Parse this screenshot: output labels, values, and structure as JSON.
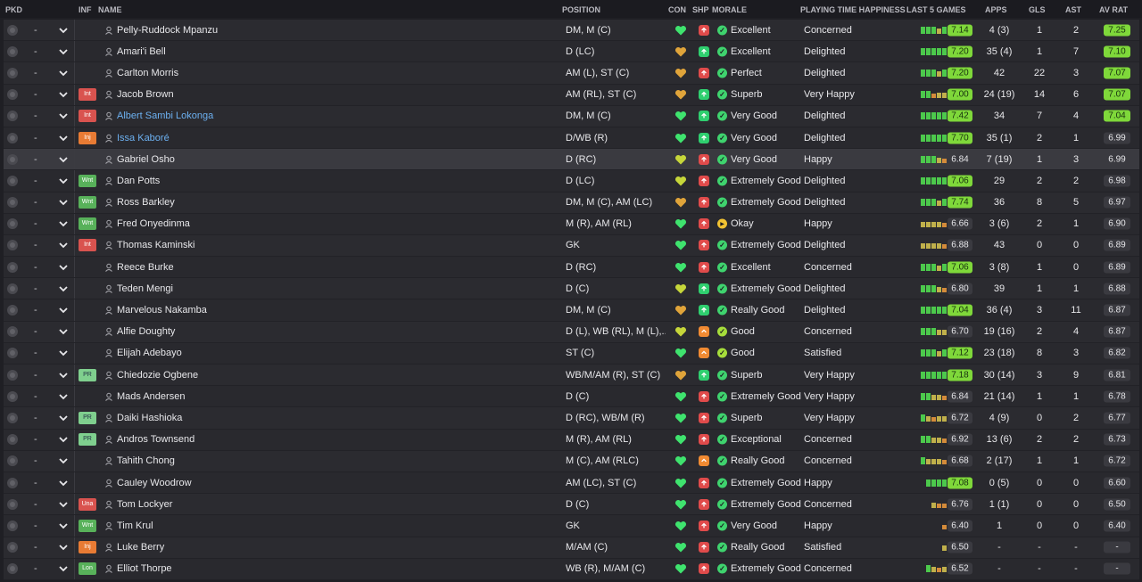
{
  "headers": {
    "pkd": "PKD",
    "inf": "INF",
    "name": "NAME",
    "position": "POSITION",
    "con": "CON",
    "shp": "SHP",
    "morale": "MORALE",
    "pth": "PLAYING TIME HAPPINESS",
    "last5": "LAST 5 GAMES",
    "apps": "APPS",
    "gls": "GLS",
    "ast": "AST",
    "avrat": "AV RAT"
  },
  "colors": {
    "rating_high": "#7fd83a",
    "link": "#6cb0f0",
    "status_red": "#d9534f",
    "status_orange": "#e87b34",
    "status_green": "#58b15a"
  },
  "rows": [
    {
      "pkd": "-",
      "inf": "",
      "name": "Pelly-Ruddock Mpanzu",
      "link": false,
      "position": "DM, M (C)",
      "con": "#3fe36e",
      "shp": "red",
      "morale_icon": "green",
      "morale": "Excellent",
      "pth": "Concerned",
      "l5": [
        "g",
        "g",
        "g",
        "y",
        "g"
      ],
      "rating": "7.14",
      "rating_hi": true,
      "apps": "4 (3)",
      "gls": "1",
      "ast": "2",
      "avrat": "7.25",
      "avrat_hi": true
    },
    {
      "pkd": "-",
      "inf": "",
      "name": "Amari'i Bell",
      "link": false,
      "position": "D (LC)",
      "con": "#e0a43a",
      "shp": "green",
      "morale_icon": "green",
      "morale": "Excellent",
      "pth": "Delighted",
      "l5": [
        "g",
        "g",
        "g",
        "g",
        "g"
      ],
      "rating": "7.20",
      "rating_hi": true,
      "apps": "35 (4)",
      "gls": "1",
      "ast": "7",
      "avrat": "7.10",
      "avrat_hi": true
    },
    {
      "pkd": "-",
      "inf": "",
      "name": "Carlton Morris",
      "link": false,
      "position": "AM (L), ST (C)",
      "con": "#e0a43a",
      "shp": "red",
      "morale_icon": "green",
      "morale": "Perfect",
      "pth": "Delighted",
      "l5": [
        "g",
        "g",
        "g",
        "y",
        "g"
      ],
      "rating": "7.20",
      "rating_hi": true,
      "apps": "42",
      "gls": "22",
      "ast": "3",
      "avrat": "7.07",
      "avrat_hi": true
    },
    {
      "pkd": "-",
      "inf": "Int",
      "name": "Jacob Brown",
      "link": false,
      "position": "AM (RL), ST (C)",
      "con": "#e0a43a",
      "shp": "green",
      "morale_icon": "green",
      "morale": "Superb",
      "pth": "Very Happy",
      "l5": [
        "g",
        "g",
        "o",
        "y",
        "y"
      ],
      "rating": "7.00",
      "rating_hi": true,
      "apps": "24 (19)",
      "gls": "14",
      "ast": "6",
      "avrat": "7.07",
      "avrat_hi": true
    },
    {
      "pkd": "-",
      "inf": "Int",
      "name": "Albert Sambi Lokonga",
      "link": true,
      "position": "DM, M (C)",
      "con": "#3fe36e",
      "shp": "green",
      "morale_icon": "green",
      "morale": "Very Good",
      "pth": "Delighted",
      "l5": [
        "g",
        "g",
        "g",
        "g",
        "g"
      ],
      "rating": "7.42",
      "rating_hi": true,
      "apps": "34",
      "gls": "7",
      "ast": "4",
      "avrat": "7.04",
      "avrat_hi": true
    },
    {
      "pkd": "-",
      "inf": "Inj",
      "name": "Issa Kaboré",
      "link": true,
      "position": "D/WB (R)",
      "con": "#3fe36e",
      "shp": "green",
      "morale_icon": "green",
      "morale": "Very Good",
      "pth": "Delighted",
      "l5": [
        "g",
        "g",
        "g",
        "g",
        "g"
      ],
      "rating": "7.70",
      "rating_hi": true,
      "apps": "35 (1)",
      "gls": "2",
      "ast": "1",
      "avrat": "6.99",
      "avrat_hi": false
    },
    {
      "pkd": "-",
      "inf": "",
      "name": "Gabriel Osho",
      "link": false,
      "position": "D (RC)",
      "con": "#c6d63a",
      "shp": "red",
      "morale_icon": "green",
      "morale": "Very Good",
      "pth": "Happy",
      "l5": [
        "g",
        "g",
        "g",
        "y",
        "o"
      ],
      "rating": "6.84",
      "rating_hi": false,
      "apps": "7 (19)",
      "gls": "1",
      "ast": "3",
      "avrat": "6.99",
      "avrat_hi": false
    },
    {
      "pkd": "-",
      "inf": "Wnt",
      "name": "Dan Potts",
      "link": false,
      "position": "D (LC)",
      "con": "#c6d63a",
      "shp": "red",
      "morale_icon": "green",
      "morale": "Extremely Good",
      "pth": "Delighted",
      "l5": [
        "g",
        "g",
        "g",
        "g",
        "g"
      ],
      "rating": "7.06",
      "rating_hi": true,
      "apps": "29",
      "gls": "2",
      "ast": "2",
      "avrat": "6.98",
      "avrat_hi": false
    },
    {
      "pkd": "-",
      "inf": "Wnt",
      "name": "Ross Barkley",
      "link": false,
      "position": "DM, M (C), AM (LC)",
      "con": "#e0a43a",
      "shp": "red",
      "morale_icon": "green",
      "morale": "Extremely Good",
      "pth": "Delighted",
      "l5": [
        "g",
        "g",
        "g",
        "y",
        "g"
      ],
      "rating": "7.74",
      "rating_hi": true,
      "apps": "36",
      "gls": "8",
      "ast": "5",
      "avrat": "6.97",
      "avrat_hi": false
    },
    {
      "pkd": "-",
      "inf": "Wnt",
      "name": "Fred Onyedinma",
      "link": false,
      "position": "M (R), AM (RL)",
      "con": "#3fe36e",
      "shp": "red",
      "morale_icon": "yellow",
      "morale": "Okay",
      "pth": "Happy",
      "l5": [
        "y",
        "y",
        "y",
        "y",
        "o"
      ],
      "rating": "6.66",
      "rating_hi": false,
      "apps": "3 (6)",
      "gls": "2",
      "ast": "1",
      "avrat": "6.90",
      "avrat_hi": false
    },
    {
      "pkd": "-",
      "inf": "Int",
      "name": "Thomas Kaminski",
      "link": false,
      "position": "GK",
      "con": "#3fe36e",
      "shp": "red",
      "morale_icon": "green",
      "morale": "Extremely Good",
      "pth": "Delighted",
      "l5": [
        "y",
        "y",
        "y",
        "y",
        "o"
      ],
      "rating": "6.88",
      "rating_hi": false,
      "apps": "43",
      "gls": "0",
      "ast": "0",
      "avrat": "6.89",
      "avrat_hi": false
    },
    {
      "pkd": "-",
      "inf": "",
      "name": "Reece Burke",
      "link": false,
      "position": "D (RC)",
      "con": "#3fe36e",
      "shp": "red",
      "morale_icon": "green",
      "morale": "Excellent",
      "pth": "Concerned",
      "l5": [
        "g",
        "g",
        "g",
        "y",
        "g"
      ],
      "rating": "7.06",
      "rating_hi": true,
      "apps": "3 (8)",
      "gls": "1",
      "ast": "0",
      "avrat": "6.89",
      "avrat_hi": false
    },
    {
      "pkd": "-",
      "inf": "",
      "name": "Teden Mengi",
      "link": false,
      "position": "D (C)",
      "con": "#c6d63a",
      "shp": "green",
      "morale_icon": "green",
      "morale": "Extremely Good",
      "pth": "Delighted",
      "l5": [
        "g",
        "g",
        "g",
        "y",
        "o"
      ],
      "rating": "6.80",
      "rating_hi": false,
      "apps": "39",
      "gls": "1",
      "ast": "1",
      "avrat": "6.88",
      "avrat_hi": false
    },
    {
      "pkd": "-",
      "inf": "",
      "name": "Marvelous Nakamba",
      "link": false,
      "position": "DM, M (C)",
      "con": "#e0a43a",
      "shp": "green",
      "morale_icon": "green",
      "morale": "Really Good",
      "pth": "Delighted",
      "l5": [
        "g",
        "g",
        "g",
        "g",
        "g"
      ],
      "rating": "7.04",
      "rating_hi": true,
      "apps": "36 (4)",
      "gls": "3",
      "ast": "11",
      "avrat": "6.87",
      "avrat_hi": false
    },
    {
      "pkd": "-",
      "inf": "",
      "name": "Alfie Doughty",
      "link": false,
      "position": "D (L), WB (RL), M (L),...",
      "con": "#c6d63a",
      "shp": "orange",
      "morale_icon": "lime",
      "morale": "Good",
      "pth": "Concerned",
      "l5": [
        "g",
        "g",
        "g",
        "y",
        "y"
      ],
      "rating": "6.70",
      "rating_hi": false,
      "apps": "19 (16)",
      "gls": "2",
      "ast": "4",
      "avrat": "6.87",
      "avrat_hi": false
    },
    {
      "pkd": "-",
      "inf": "",
      "name": "Elijah Adebayo",
      "link": false,
      "position": "ST (C)",
      "con": "#3fe36e",
      "shp": "orange",
      "morale_icon": "lime",
      "morale": "Good",
      "pth": "Satisfied",
      "l5": [
        "g",
        "g",
        "g",
        "y",
        "g"
      ],
      "rating": "7.12",
      "rating_hi": true,
      "apps": "23 (18)",
      "gls": "8",
      "ast": "3",
      "avrat": "6.82",
      "avrat_hi": false
    },
    {
      "pkd": "-",
      "inf": "PR",
      "name": "Chiedozie Ogbene",
      "link": false,
      "position": "WB/M/AM (R), ST (C)",
      "con": "#e0a43a",
      "shp": "green",
      "morale_icon": "green",
      "morale": "Superb",
      "pth": "Very Happy",
      "l5": [
        "g",
        "g",
        "g",
        "g",
        "g"
      ],
      "rating": "7.18",
      "rating_hi": true,
      "apps": "30 (14)",
      "gls": "3",
      "ast": "9",
      "avrat": "6.81",
      "avrat_hi": false
    },
    {
      "pkd": "-",
      "inf": "",
      "name": "Mads Andersen",
      "link": false,
      "position": "D (C)",
      "con": "#3fe36e",
      "shp": "red",
      "morale_icon": "green",
      "morale": "Extremely Good",
      "pth": "Very Happy",
      "l5": [
        "g",
        "g",
        "y",
        "y",
        "o"
      ],
      "rating": "6.84",
      "rating_hi": false,
      "apps": "21 (14)",
      "gls": "1",
      "ast": "1",
      "avrat": "6.78",
      "avrat_hi": false
    },
    {
      "pkd": "-",
      "inf": "PR",
      "name": "Daiki Hashioka",
      "link": false,
      "position": "D (RC), WB/M (R)",
      "con": "#3fe36e",
      "shp": "red",
      "morale_icon": "green",
      "morale": "Superb",
      "pth": "Very Happy",
      "l5": [
        "g",
        "y",
        "o",
        "y",
        "y"
      ],
      "rating": "6.72",
      "rating_hi": false,
      "apps": "4 (9)",
      "gls": "0",
      "ast": "2",
      "avrat": "6.77",
      "avrat_hi": false
    },
    {
      "pkd": "-",
      "inf": "PR",
      "name": "Andros Townsend",
      "link": false,
      "position": "M (R), AM (RL)",
      "con": "#3fe36e",
      "shp": "red",
      "morale_icon": "green",
      "morale": "Exceptional",
      "pth": "Concerned",
      "l5": [
        "g",
        "g",
        "y",
        "y",
        "o"
      ],
      "rating": "6.92",
      "rating_hi": false,
      "apps": "13 (6)",
      "gls": "2",
      "ast": "2",
      "avrat": "6.73",
      "avrat_hi": false
    },
    {
      "pkd": "-",
      "inf": "",
      "name": "Tahith Chong",
      "link": false,
      "position": "M (C), AM (RLC)",
      "con": "#3fe36e",
      "shp": "orange",
      "morale_icon": "green",
      "morale": "Really Good",
      "pth": "Concerned",
      "l5": [
        "g",
        "y",
        "y",
        "y",
        "o"
      ],
      "rating": "6.68",
      "rating_hi": false,
      "apps": "2 (17)",
      "gls": "1",
      "ast": "1",
      "avrat": "6.72",
      "avrat_hi": false
    },
    {
      "pkd": "-",
      "inf": "",
      "name": "Cauley Woodrow",
      "link": false,
      "position": "AM (LC), ST (C)",
      "con": "#3fe36e",
      "shp": "red",
      "morale_icon": "green",
      "morale": "Extremely Good",
      "pth": "Happy",
      "l5": [
        "g",
        "g",
        "g",
        "g"
      ],
      "rating": "7.08",
      "rating_hi": true,
      "apps": "0 (5)",
      "gls": "0",
      "ast": "0",
      "avrat": "6.60",
      "avrat_hi": false
    },
    {
      "pkd": "-",
      "inf": "Una",
      "name": "Tom Lockyer",
      "link": false,
      "position": "D (C)",
      "con": "#3fe36e",
      "shp": "red",
      "morale_icon": "green",
      "morale": "Extremely Good",
      "pth": "Concerned",
      "l5": [
        "y",
        "o",
        "o"
      ],
      "rating": "6.76",
      "rating_hi": false,
      "apps": "1 (1)",
      "gls": "0",
      "ast": "0",
      "avrat": "6.50",
      "avrat_hi": false
    },
    {
      "pkd": "-",
      "inf": "Wnt",
      "name": "Tim Krul",
      "link": false,
      "position": "GK",
      "con": "#3fe36e",
      "shp": "red",
      "morale_icon": "green",
      "morale": "Very Good",
      "pth": "Happy",
      "l5": [
        "o"
      ],
      "rating": "6.40",
      "rating_hi": false,
      "apps": "1",
      "gls": "0",
      "ast": "0",
      "avrat": "6.40",
      "avrat_hi": false
    },
    {
      "pkd": "-",
      "inf": "Inj",
      "name": "Luke Berry",
      "link": false,
      "position": "M/AM (C)",
      "con": "#3fe36e",
      "shp": "red",
      "morale_icon": "green",
      "morale": "Really Good",
      "pth": "Satisfied",
      "l5": [
        "y"
      ],
      "rating": "6.50",
      "rating_hi": false,
      "apps": "-",
      "gls": "-",
      "ast": "-",
      "avrat": "-",
      "avrat_hi": false
    },
    {
      "pkd": "-",
      "inf": "Lon",
      "name": "Elliot Thorpe",
      "link": false,
      "position": "WB (R), M/AM (C)",
      "con": "#3fe36e",
      "shp": "red",
      "morale_icon": "green",
      "morale": "Extremely Good",
      "pth": "Concerned",
      "l5": [
        "g",
        "y",
        "o",
        "y"
      ],
      "rating": "6.52",
      "rating_hi": false,
      "apps": "-",
      "gls": "-",
      "ast": "-",
      "avrat": "-",
      "avrat_hi": false
    }
  ]
}
